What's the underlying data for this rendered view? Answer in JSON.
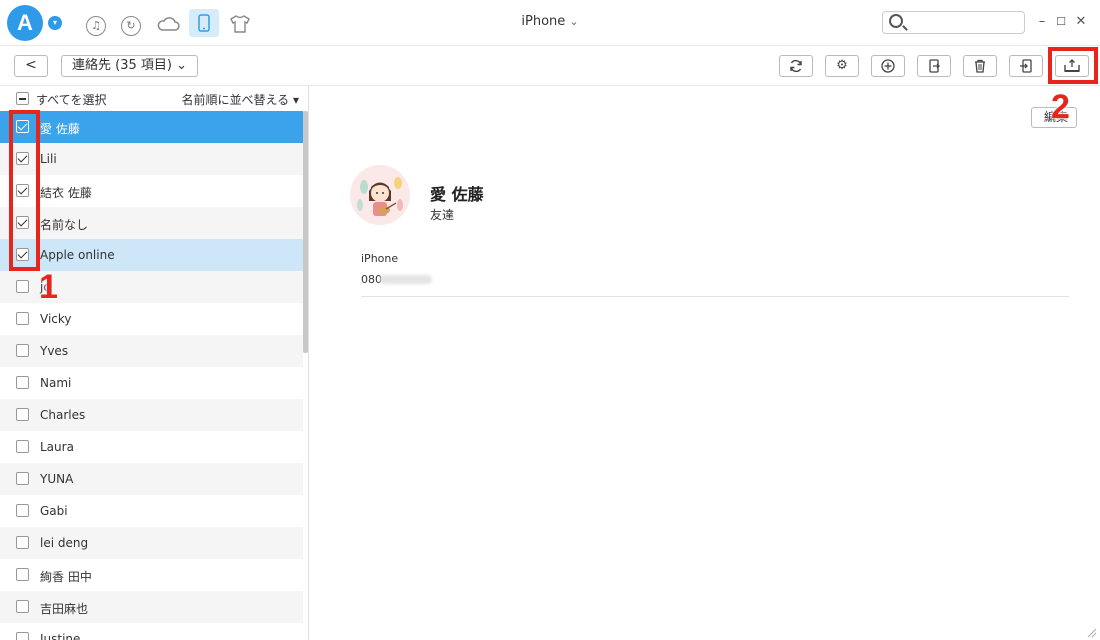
{
  "titlebar": {
    "logo_letter": "A",
    "device_name": "iPhone",
    "device_caret": "⌄",
    "search": {
      "value": "",
      "placeholder": ""
    },
    "icons": [
      "music-icon",
      "history-icon",
      "cloud-icon",
      "phone-icon",
      "tshirt-icon"
    ],
    "window_controls": {
      "minimize": "–",
      "maximize": "☐",
      "close": "✕"
    }
  },
  "toolbar": {
    "back": "<",
    "category": "連絡先 (35 項目) ⌄",
    "buttons": [
      "refresh",
      "settings",
      "add",
      "export-to-device",
      "delete",
      "import",
      "export-to-pc"
    ]
  },
  "list": {
    "select_all": "すべてを選択",
    "sort": "名前順に並べ替える ▾",
    "contacts": [
      {
        "name": "愛 佐藤",
        "checked": true
      },
      {
        "name": "Lili",
        "checked": true
      },
      {
        "name": "結衣 佐藤",
        "checked": true
      },
      {
        "name": "名前なし",
        "checked": true
      },
      {
        "name": "Apple online",
        "checked": true
      },
      {
        "name": "jo",
        "checked": false
      },
      {
        "name": "Vicky",
        "checked": false
      },
      {
        "name": "Yves",
        "checked": false
      },
      {
        "name": "Nami",
        "checked": false
      },
      {
        "name": "Charles",
        "checked": false
      },
      {
        "name": "Laura",
        "checked": false
      },
      {
        "name": "YUNA",
        "checked": false
      },
      {
        "name": "Gabi",
        "checked": false
      },
      {
        "name": "lei deng",
        "checked": false
      },
      {
        "name": "絢香 田中",
        "checked": false
      },
      {
        "name": "吉田麻也",
        "checked": false
      },
      {
        "name": "Justine",
        "checked": false
      }
    ]
  },
  "detail": {
    "edit_label": "編集",
    "name": "愛 佐藤",
    "group": "友達",
    "phone_label": "iPhone",
    "phone_prefix": "080"
  },
  "annotations": {
    "step1": "1",
    "step2": "2"
  },
  "colors": {
    "accent": "#3ba3ec",
    "highlight": "#e6251d"
  }
}
